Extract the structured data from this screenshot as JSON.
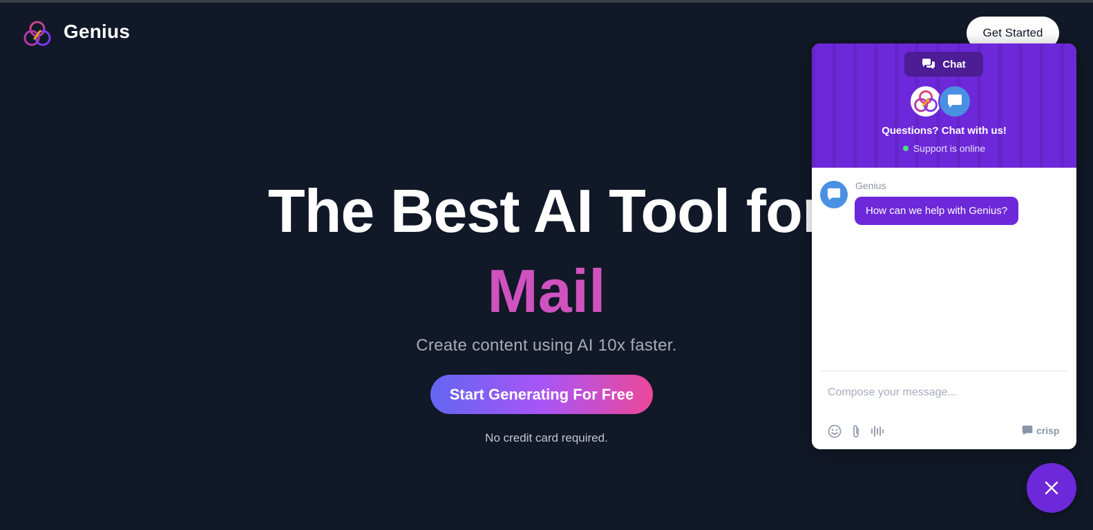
{
  "nav": {
    "brand": "Genius",
    "cta_label": "Get Started"
  },
  "hero": {
    "title": "The Best AI Tool for",
    "typed_word": "Mail",
    "subtitle": "Create content using AI 10x faster.",
    "cta_label": "Start Generating For Free",
    "note": "No credit card required."
  },
  "chat": {
    "tab_label": "Chat",
    "title": "Questions? Chat with us!",
    "status": "Support is online",
    "message": {
      "sender": "Genius",
      "text": "How can we help with Genius?"
    },
    "compose_placeholder": "Compose your message...",
    "tools": [
      "emoji-icon",
      "attachment-icon",
      "voice-icon"
    ],
    "brand": "crisp"
  },
  "colors": {
    "background": "#111827",
    "accent_purple": "#6d28d9",
    "hero_word": "#cf52bf",
    "cta_gradient": [
      "#6366f1",
      "#a855f7",
      "#ec4899"
    ],
    "online": "#4ade80"
  },
  "icons": {
    "logo": "genius-knot-logo",
    "chat_tab": "chat-bubbles-icon",
    "close": "close-icon"
  }
}
